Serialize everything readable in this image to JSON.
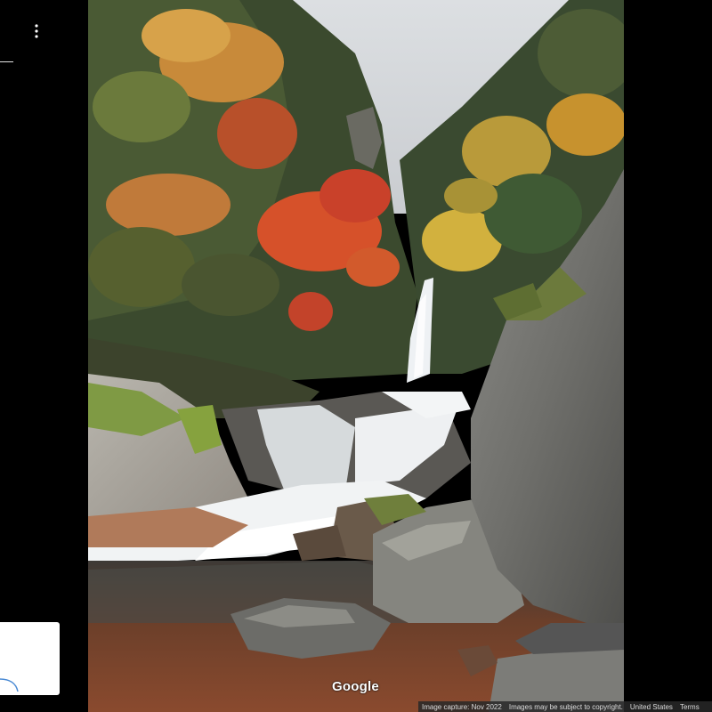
{
  "viewer": {
    "logo": "Google",
    "menu_icon": "more-vert-icon"
  },
  "footer": {
    "capture_date": "Image capture: Nov 2022",
    "copyright": "Images may be subject to copyright.",
    "region": "United States",
    "terms": "Terms"
  },
  "colors": {
    "background": "#000000",
    "minimap_bg": "#ffffff",
    "footer_bg": "#282828",
    "route_line": "#4a8ad4"
  }
}
